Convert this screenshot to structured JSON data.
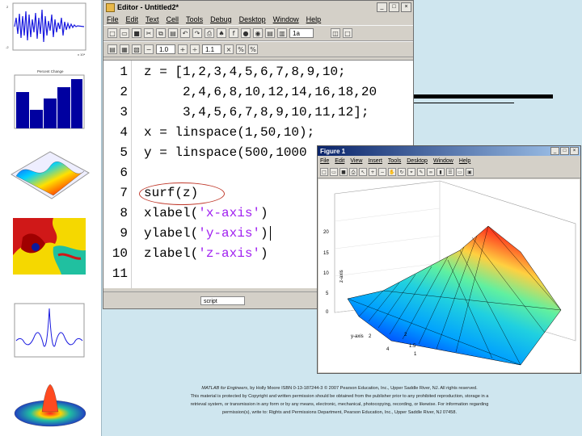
{
  "editor": {
    "title": "Editor - Untitled2*",
    "menu": [
      "File",
      "Edit",
      "Text",
      "Cell",
      "Tools",
      "Debug",
      "Desktop",
      "Window",
      "Help"
    ],
    "toolbar2": {
      "field1": "1.0",
      "field2": "1.1"
    },
    "zoom_field": "1a",
    "status_box": "script",
    "lines": [
      {
        "n": "1",
        "code": "z = [1,2,3,4,5,6,7,8,9,10;"
      },
      {
        "n": "2",
        "code": "     2,4,6,8,10,12,14,16,18,20"
      },
      {
        "n": "3",
        "code": "     3,4,5,6,7,8,9,10,11,12];"
      },
      {
        "n": "4",
        "code": "x = linspace(1,50,10);"
      },
      {
        "n": "5",
        "code": "y = linspace(500,1000"
      },
      {
        "n": "6",
        "code": ""
      },
      {
        "n": "7",
        "code": "surf(z)"
      },
      {
        "n": "8",
        "code_pre": "xlabel(",
        "code_str": "'x-axis'",
        "code_post": ")"
      },
      {
        "n": "9",
        "code_pre": "ylabel(",
        "code_str": "'y-axis'",
        "code_post": ")"
      },
      {
        "n": "10",
        "code_pre": "zlabel(",
        "code_str": "'z-axis'",
        "code_post": ")"
      },
      {
        "n": "11",
        "code": ""
      }
    ]
  },
  "figure": {
    "title": "Figure 1",
    "menu": [
      "File",
      "Edit",
      "View",
      "Insert",
      "Tools",
      "Desktop",
      "Window",
      "Help"
    ],
    "z_ticks": [
      "20",
      "15",
      "10",
      "5",
      "0"
    ],
    "x_ticks": [
      "1",
      "1.5",
      "2"
    ],
    "y_ticks": [
      "2",
      "4"
    ],
    "z_label": "z-axis",
    "y_label": "y-axis"
  },
  "thumbnails": {
    "hist_title": "Percent Change",
    "x_note": "x 10⁴"
  },
  "footer": {
    "line1_title": "MATLAB for Engineers",
    "line1": ", by Holly Moore ISBN 0-13-187244-3 © 2007 Pearson Education, Inc., Upper Saddle River, NJ. All rights reserved.",
    "line2": "This material is protected by Copyright and written permission should be obtained from the publisher prior to any prohibited reproduction, storage in a",
    "line3": "retrieval system, or transmission in any form or by any means, electronic, mechanical, photocopying, recording, or likewise. For information regarding",
    "line4": "permission(s), write to: Rights and Permissions Department, Pearson Education, Inc., Upper Saddle River, NJ 07458."
  },
  "colors": {
    "background": "#cfe6ef",
    "string": "#a020f0",
    "highlight_circle": "#c0392b"
  }
}
